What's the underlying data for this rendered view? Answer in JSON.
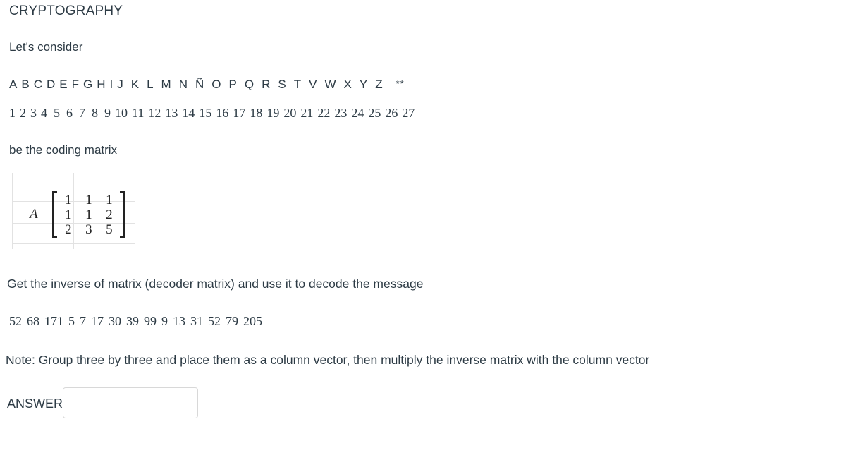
{
  "page": {
    "title": "CRYPTOGRAPHY",
    "intro": "Let's consider",
    "coding_matrix_caption": "be the coding matrix",
    "decode_instruction": "Get the inverse of matrix (decoder matrix) and use it to decode the message",
    "note": "Note: Group three by three and place them as a column vector, then multiply the inverse matrix with the column vector",
    "text_color": "#2d3b45",
    "grid_color": "#e2e2e2",
    "input_border_color": "#d8d8d8"
  },
  "cipher_key": {
    "letters": [
      "A",
      "B",
      "C",
      "D",
      "E",
      "F",
      "G",
      "H",
      "I",
      "J",
      "K",
      "L",
      "M",
      "N",
      "Ñ",
      "O",
      "P",
      "Q",
      "R",
      "S",
      "T",
      "V",
      "W",
      "X",
      "Y",
      "Z",
      "**"
    ],
    "numbers": [
      1,
      2,
      3,
      4,
      5,
      6,
      7,
      8,
      9,
      10,
      11,
      12,
      13,
      14,
      15,
      16,
      17,
      18,
      19,
      20,
      21,
      22,
      23,
      24,
      25,
      26,
      27
    ]
  },
  "matrix": {
    "name": "A",
    "equals": "=",
    "rows": [
      [
        1,
        1,
        1
      ],
      [
        1,
        1,
        2
      ],
      [
        2,
        3,
        5
      ]
    ]
  },
  "message": {
    "values": [
      52,
      68,
      171,
      5,
      7,
      17,
      30,
      39,
      99,
      9,
      13,
      31,
      52,
      79,
      205
    ]
  },
  "answer": {
    "label": "ANSWER",
    "value": "",
    "placeholder": ""
  }
}
